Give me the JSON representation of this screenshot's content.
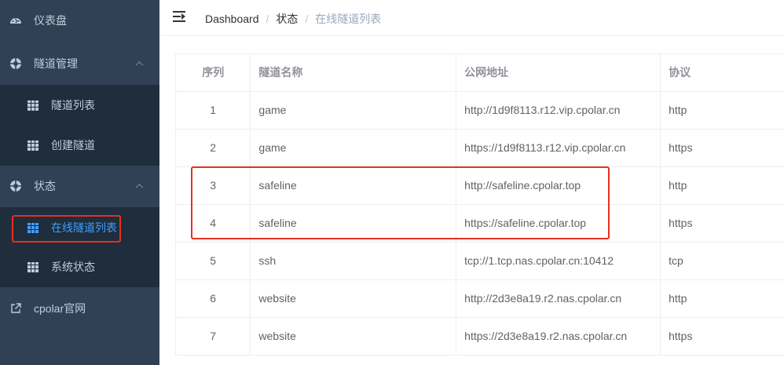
{
  "sidebar": {
    "items": [
      {
        "label": "仪表盘",
        "icon": "dashboard-icon"
      },
      {
        "label": "隧道管理",
        "icon": "lifebuoy-icon"
      },
      {
        "label": "隧道列表",
        "icon": "grid-icon"
      },
      {
        "label": "创建隧道",
        "icon": "grid-icon"
      },
      {
        "label": "状态",
        "icon": "lifebuoy-icon"
      },
      {
        "label": "在线隧道列表",
        "icon": "grid-icon"
      },
      {
        "label": "系统状态",
        "icon": "grid-icon"
      },
      {
        "label": "cpolar官网",
        "icon": "external-link-icon"
      }
    ]
  },
  "header": {
    "breadcrumb": [
      "Dashboard",
      "状态",
      "在线隧道列表"
    ]
  },
  "table": {
    "columns": [
      "序列",
      "隧道名称",
      "公网地址",
      "协议"
    ],
    "rows": [
      {
        "idx": "1",
        "name": "game",
        "url": "http://1d9f8113.r12.vip.cpolar.cn",
        "proto": "http"
      },
      {
        "idx": "2",
        "name": "game",
        "url": "https://1d9f8113.r12.vip.cpolar.cn",
        "proto": "https"
      },
      {
        "idx": "3",
        "name": "safeline",
        "url": "http://safeline.cpolar.top",
        "proto": "http"
      },
      {
        "idx": "4",
        "name": "safeline",
        "url": "https://safeline.cpolar.top",
        "proto": "https"
      },
      {
        "idx": "5",
        "name": "ssh",
        "url": "tcp://1.tcp.nas.cpolar.cn:10412",
        "proto": "tcp"
      },
      {
        "idx": "6",
        "name": "website",
        "url": "http://2d3e8a19.r2.nas.cpolar.cn",
        "proto": "http"
      },
      {
        "idx": "7",
        "name": "website",
        "url": "https://2d3e8a19.r2.nas.cpolar.cn",
        "proto": "https"
      }
    ]
  },
  "colors": {
    "sidebar_bg": "#304156",
    "submenu_bg": "#1f2d3d",
    "active": "#409eff",
    "highlight_box": "#e8301f"
  }
}
